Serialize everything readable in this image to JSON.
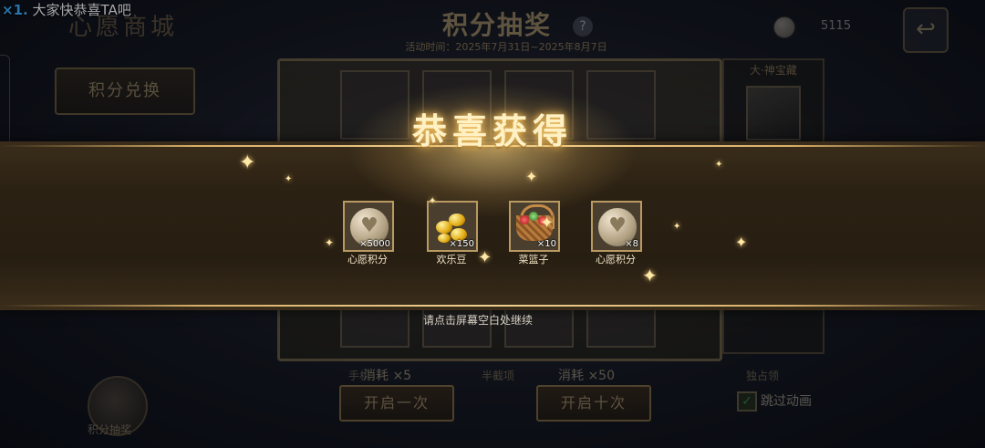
{
  "banner": {
    "multiplier": "×1.",
    "message": "大家快恭喜TA吧"
  },
  "shop": {
    "title": "心愿商城",
    "exchange_label": "积分兑换"
  },
  "lottery": {
    "title": "积分抽奖",
    "help_glyph": "?",
    "activity_time": "活动时间：2025年7月31日~2025年8月7日"
  },
  "currency": {
    "value": "5115"
  },
  "back_glyph": "↩",
  "right_panel": {
    "title": "大·神宝藏"
  },
  "bottom": {
    "cost_one": "消耗 ×5",
    "cost_ten": "消耗 ×50",
    "open_one": "开启一次",
    "open_ten": "开启十次",
    "skip_label": "跳过动画",
    "skip_check": "✓",
    "avatar_label": "积分抽奖",
    "mid_left": "手机",
    "mid_center": "半截项",
    "mid_right": "独占领"
  },
  "popup": {
    "title": "恭喜获得",
    "hint": "请点击屏幕空白处继续",
    "rewards": [
      {
        "name": "心愿积分",
        "qty": "×5000",
        "icon": "heart-coin"
      },
      {
        "name": "欢乐豆",
        "qty": "×150",
        "icon": "golden-beans"
      },
      {
        "name": "菜篮子",
        "qty": "×10",
        "icon": "vegetable-basket"
      },
      {
        "name": "心愿积分",
        "qty": "×8",
        "icon": "heart-coin"
      }
    ]
  },
  "colors": {
    "accent_gold": "#f0d090",
    "ribbon": "#2b2113"
  }
}
